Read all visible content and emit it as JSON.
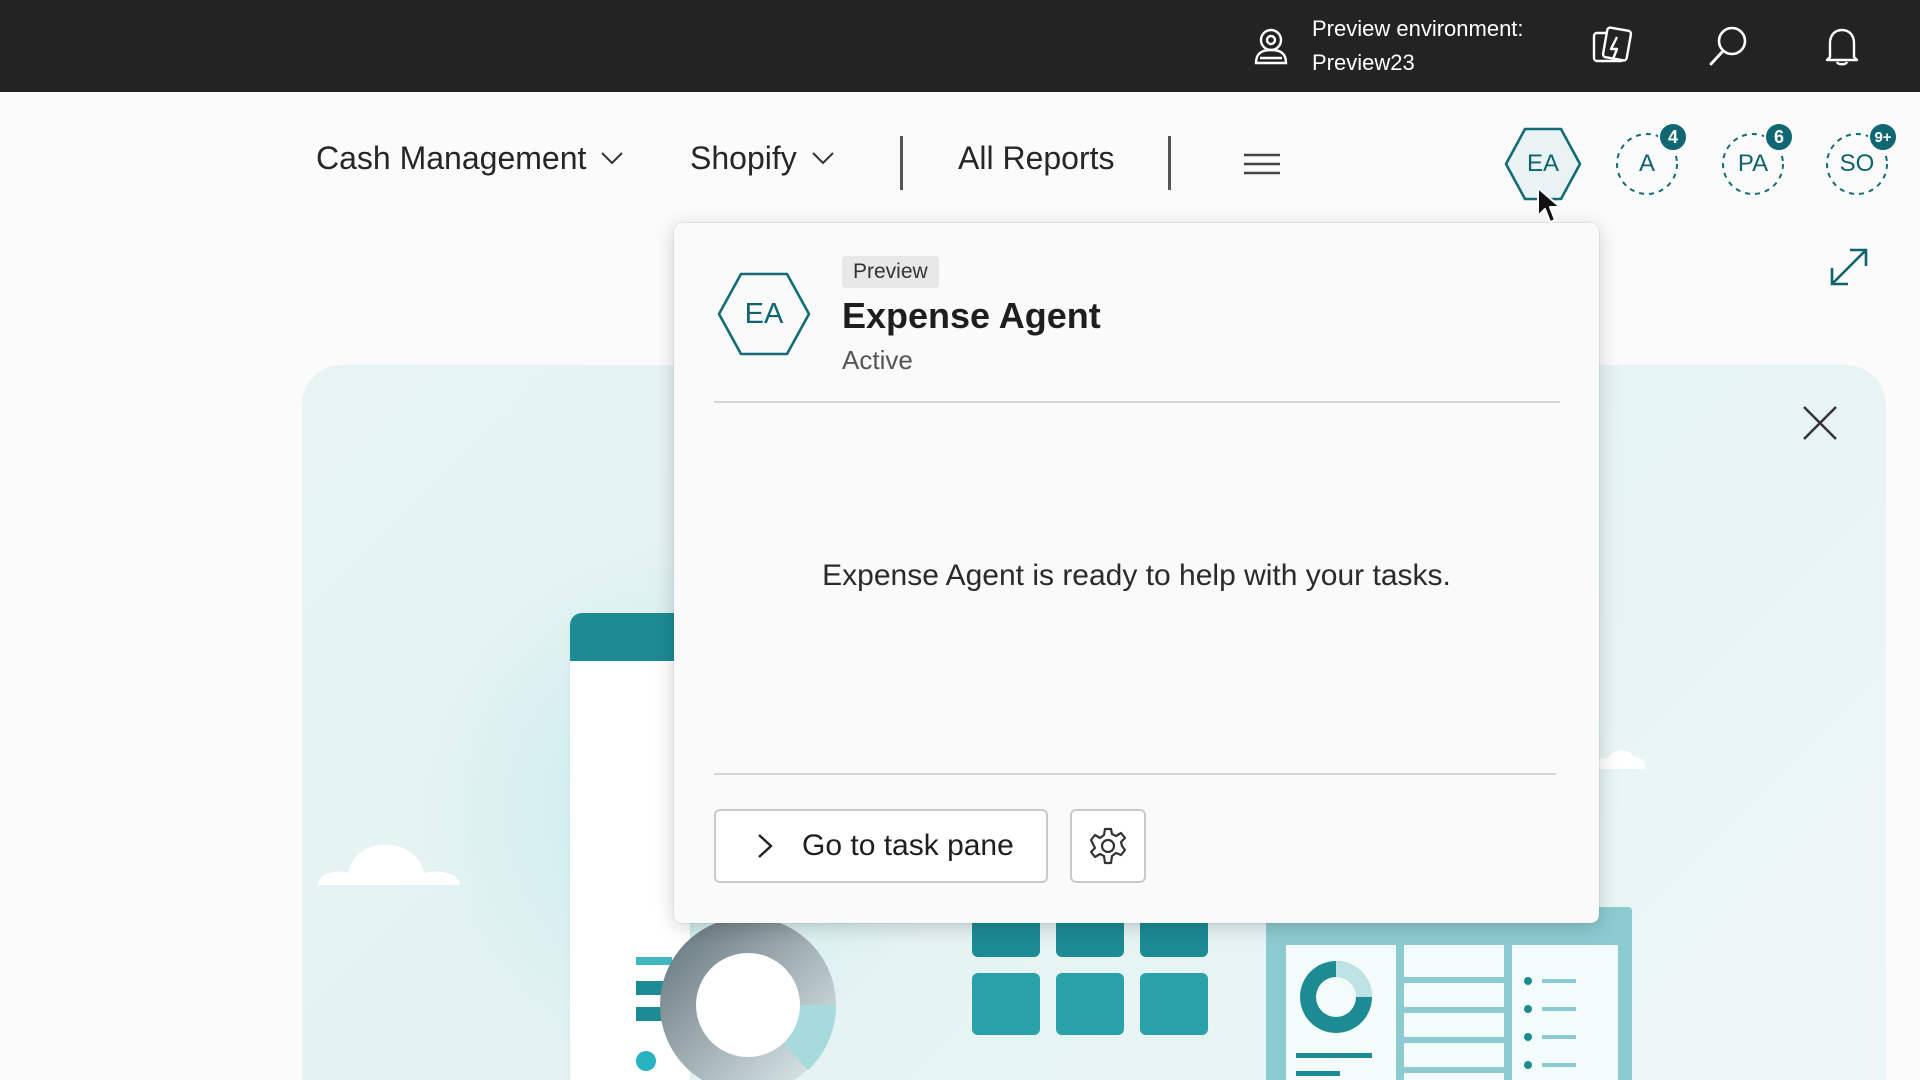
{
  "topbar": {
    "environment_line1": "Preview environment:",
    "environment_line2": "Preview23",
    "icons": [
      "environment-icon",
      "copilot-icon",
      "search-icon",
      "bell-icon"
    ]
  },
  "nav": {
    "items": [
      {
        "label": "Cash Management",
        "has_dropdown": true
      },
      {
        "label": "Shopify",
        "has_dropdown": true
      },
      {
        "label": "All Reports",
        "has_dropdown": false
      }
    ],
    "menu_icon": "hamburger-icon"
  },
  "agents": [
    {
      "initials": "EA",
      "shape": "hexagon",
      "badge": null
    },
    {
      "initials": "A",
      "shape": "dashed-circle",
      "badge": "4"
    },
    {
      "initials": "PA",
      "shape": "dashed-circle",
      "badge": "6"
    },
    {
      "initials": "SO",
      "shape": "dashed-circle",
      "badge": "9+"
    }
  ],
  "popup": {
    "avatar_initials": "EA",
    "tag": "Preview",
    "title": "Expense Agent",
    "status": "Active",
    "message": "Expense Agent is ready to help with your tasks.",
    "primary_button": "Go to task pane",
    "settings_icon": "gear-icon"
  },
  "colors": {
    "topbar_bg": "#232323",
    "accent_teal": "#0d6470",
    "badge_bg": "#0f6771",
    "illustration_teal": "#1c8b94"
  }
}
